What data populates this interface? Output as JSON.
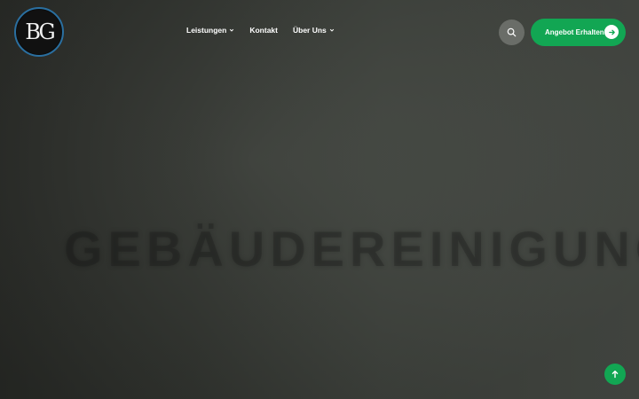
{
  "brand": {
    "logo_text": "BG"
  },
  "nav": {
    "items": [
      {
        "label": "Leistungen",
        "has_dropdown": true
      },
      {
        "label": "Kontakt",
        "has_dropdown": false
      },
      {
        "label": "Über Uns",
        "has_dropdown": true
      }
    ]
  },
  "header": {
    "search_icon": "search-icon",
    "cta_label": "Angebot Erhalten!",
    "cta_icon": "arrow-right-icon"
  },
  "hero": {
    "title": "GEBÄUDEREINIGUNG"
  },
  "scroll_top": {
    "icon": "arrow-up-icon"
  },
  "colors": {
    "accent": "#12a653",
    "logo_ring": "#2a6fa0",
    "nav_text": "#ffffff"
  }
}
